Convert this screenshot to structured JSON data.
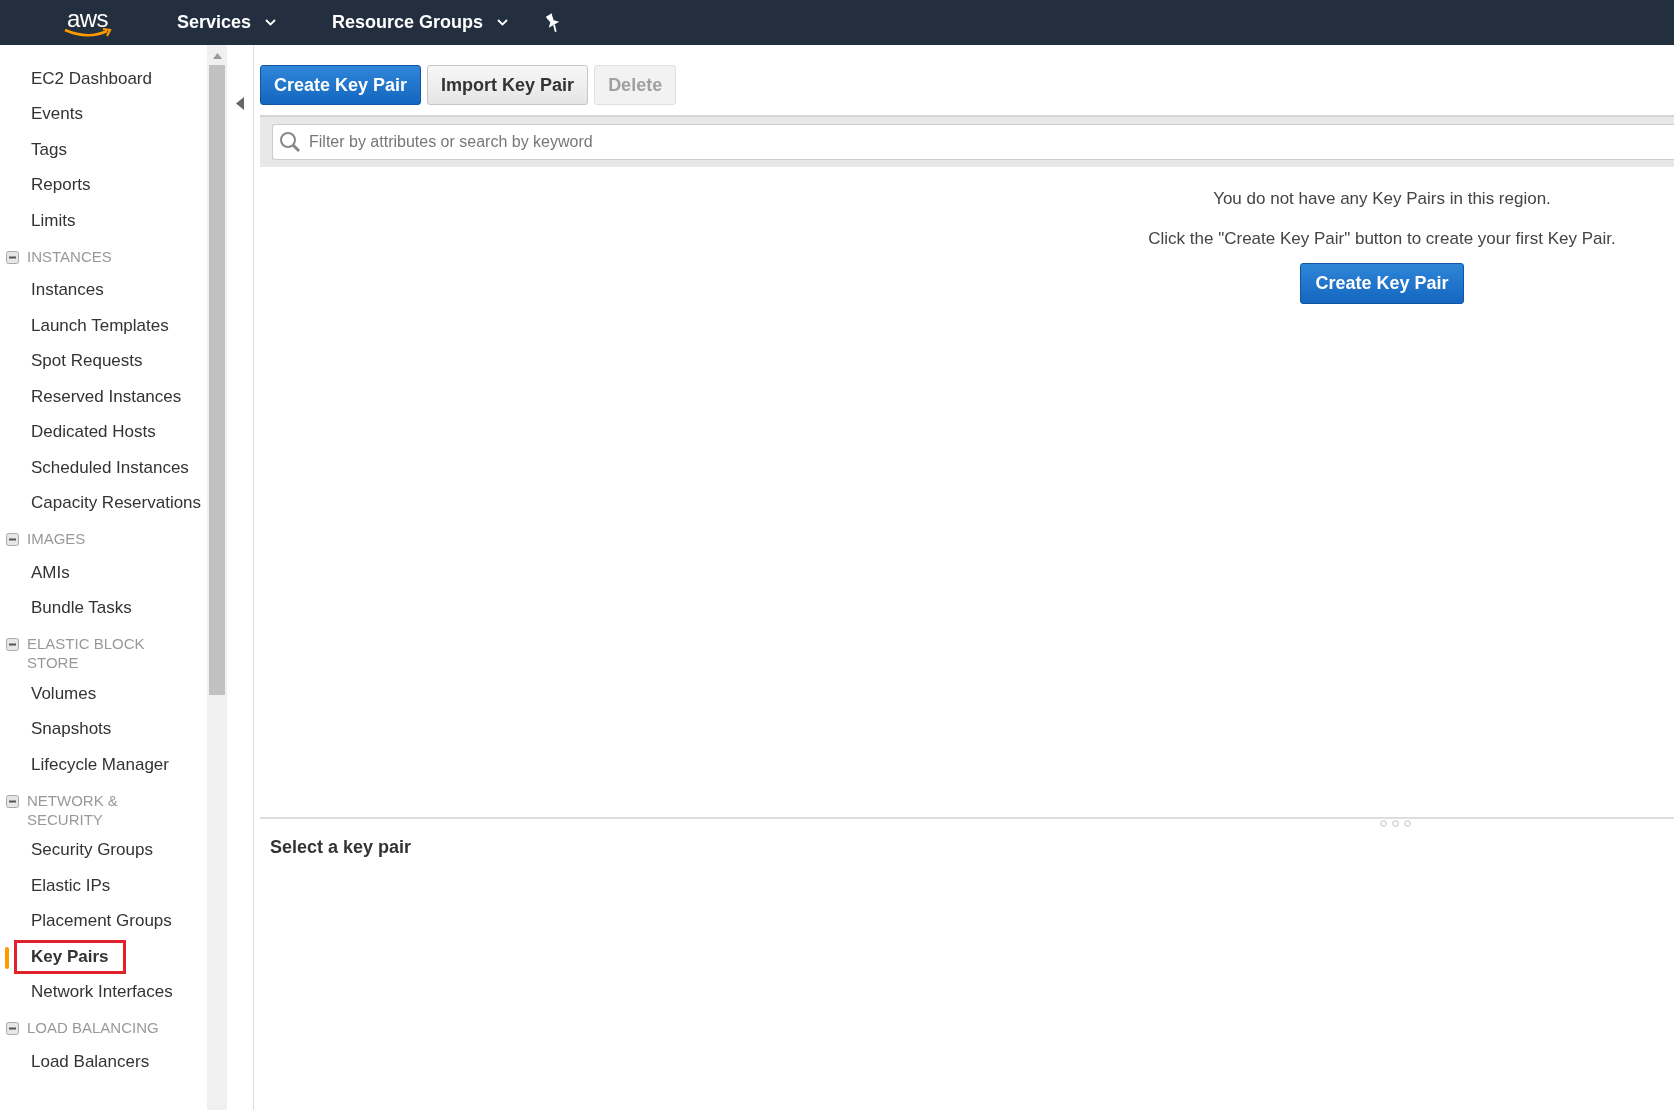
{
  "topbar": {
    "logo": "aws",
    "menus": [
      {
        "label": "Services"
      },
      {
        "label": "Resource Groups"
      }
    ]
  },
  "sidebar": {
    "groups": [
      {
        "items": [
          {
            "label": "EC2 Dashboard",
            "selected": false,
            "outlined": false
          },
          {
            "label": "Events",
            "selected": false,
            "outlined": false
          },
          {
            "label": "Tags",
            "selected": false,
            "outlined": false
          },
          {
            "label": "Reports",
            "selected": false,
            "outlined": false
          },
          {
            "label": "Limits",
            "selected": false,
            "outlined": false
          }
        ]
      },
      {
        "title": "INSTANCES",
        "expanded": true,
        "items": [
          {
            "label": "Instances",
            "selected": false,
            "outlined": false
          },
          {
            "label": "Launch Templates",
            "selected": false,
            "outlined": false
          },
          {
            "label": "Spot Requests",
            "selected": false,
            "outlined": false
          },
          {
            "label": "Reserved Instances",
            "selected": false,
            "outlined": false
          },
          {
            "label": "Dedicated Hosts",
            "selected": false,
            "outlined": false
          },
          {
            "label": "Scheduled Instances",
            "selected": false,
            "outlined": false
          },
          {
            "label": "Capacity Reservations",
            "selected": false,
            "outlined": false
          }
        ]
      },
      {
        "title": "IMAGES",
        "expanded": true,
        "items": [
          {
            "label": "AMIs",
            "selected": false,
            "outlined": false
          },
          {
            "label": "Bundle Tasks",
            "selected": false,
            "outlined": false
          }
        ]
      },
      {
        "title": "ELASTIC BLOCK STORE",
        "expanded": true,
        "items": [
          {
            "label": "Volumes",
            "selected": false,
            "outlined": false
          },
          {
            "label": "Snapshots",
            "selected": false,
            "outlined": false
          },
          {
            "label": "Lifecycle Manager",
            "selected": false,
            "outlined": false
          }
        ]
      },
      {
        "title": "NETWORK & SECURITY",
        "expanded": true,
        "items": [
          {
            "label": "Security Groups",
            "selected": false,
            "outlined": false
          },
          {
            "label": "Elastic IPs",
            "selected": false,
            "outlined": false
          },
          {
            "label": "Placement Groups",
            "selected": false,
            "outlined": false
          },
          {
            "label": "Key Pairs",
            "selected": true,
            "outlined": true
          },
          {
            "label": "Network Interfaces",
            "selected": false,
            "outlined": false
          }
        ]
      },
      {
        "title": "LOAD BALANCING",
        "expanded": true,
        "items": [
          {
            "label": "Load Balancers",
            "selected": false,
            "outlined": false
          }
        ]
      }
    ]
  },
  "toolbar": {
    "buttons": [
      {
        "label": "Create Key Pair",
        "kind": "primary",
        "disabled": false
      },
      {
        "label": "Import Key Pair",
        "kind": "default",
        "disabled": false
      },
      {
        "label": "Delete",
        "kind": "default",
        "disabled": true
      }
    ]
  },
  "filter": {
    "placeholder": "Filter by attributes or search by keyword"
  },
  "empty_state": {
    "message": "You do not have any Key Pairs in this region.",
    "hint": "Click the \"Create Key Pair\" button to create your first Key Pair.",
    "button": "Create Key Pair"
  },
  "details": {
    "title": "Select a key pair"
  }
}
